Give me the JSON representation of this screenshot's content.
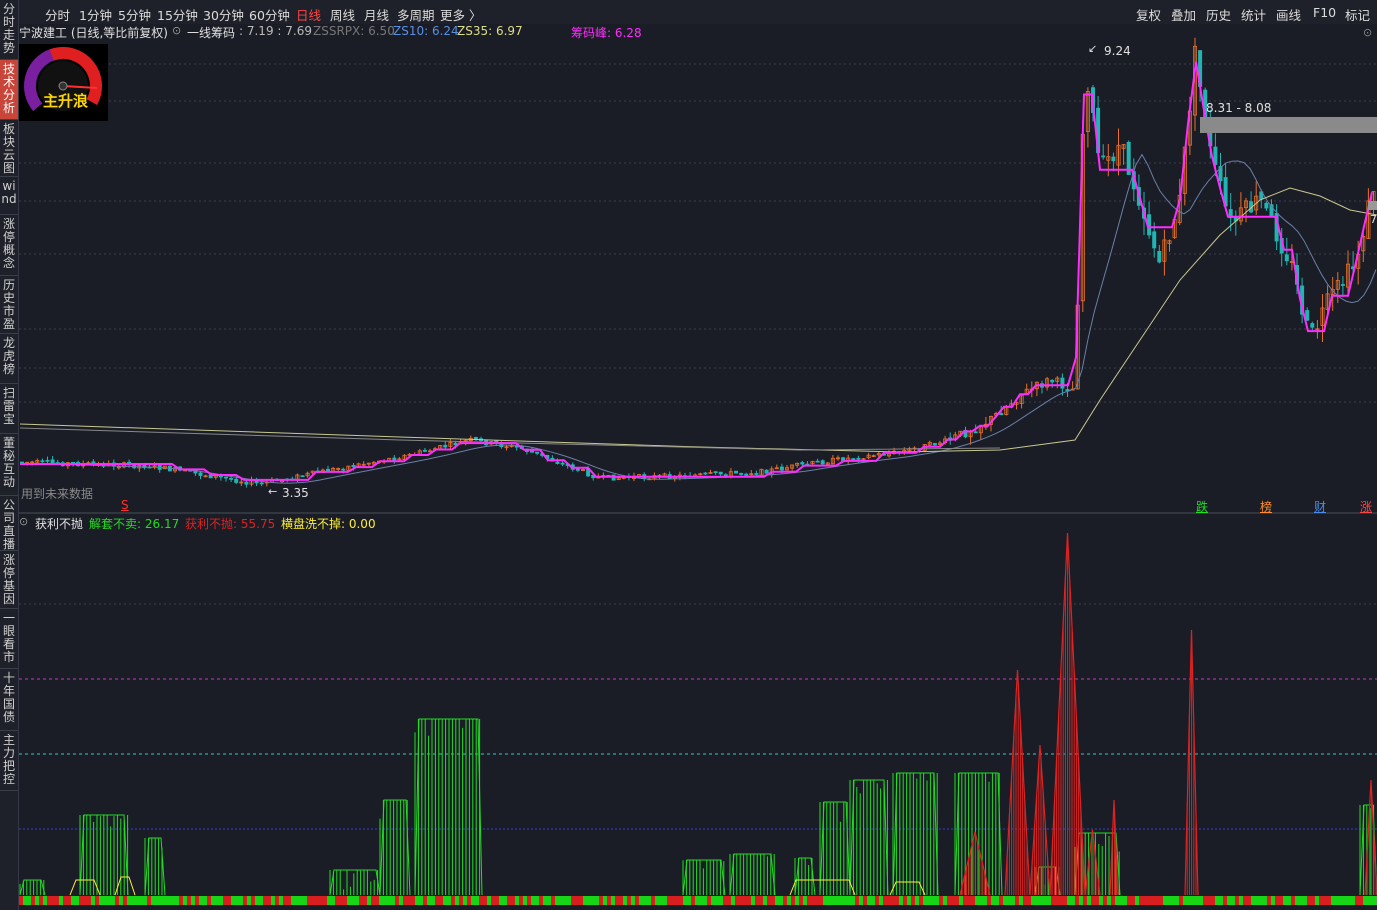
{
  "sidebar": {
    "items": [
      {
        "label": "分时走势",
        "active": false
      },
      {
        "label": "技术分析",
        "active": true
      },
      {
        "label": "板块云图",
        "active": false
      },
      {
        "label": "wind",
        "active": false
      },
      {
        "label": "涨停概念",
        "active": false
      },
      {
        "label": "历史市盈",
        "active": false
      },
      {
        "label": "龙虎榜",
        "active": false
      },
      {
        "label": "扫雷宝",
        "active": false
      },
      {
        "label": "董秘互动",
        "active": false
      },
      {
        "label": "公司直播",
        "active": false
      },
      {
        "label": "涨停基因",
        "active": false
      },
      {
        "label": "一眼看市",
        "active": false
      },
      {
        "label": "十年国债",
        "active": false
      },
      {
        "label": "主力把控",
        "active": false
      }
    ]
  },
  "toolbar": {
    "left_items": [
      {
        "label": "分时",
        "active": false
      },
      {
        "label": "1分钟",
        "active": false
      },
      {
        "label": "5分钟",
        "active": false
      },
      {
        "label": "15分钟",
        "active": false
      },
      {
        "label": "30分钟",
        "active": false
      },
      {
        "label": "60分钟",
        "active": false
      },
      {
        "label": "日线",
        "active": true
      },
      {
        "label": "周线",
        "active": false
      },
      {
        "label": "月线",
        "active": false
      },
      {
        "label": "多周期",
        "active": false
      },
      {
        "label": "更多 〉",
        "active": false
      }
    ],
    "right_items": [
      "复权",
      "叠加",
      "历史",
      "统计",
      "画线",
      "F10",
      "标记"
    ]
  },
  "main_info": {
    "title": "宁波建工 (日线,等比前复权)",
    "indicator_name": "一线筹码",
    "indicator_value": ": 7.19 : 7.69",
    "zssrpx": "ZSSRPX: 6.50",
    "zs10": "ZS10: 6.24",
    "zs35": "ZS35: 6.97",
    "chip_peak": "筹码峰: 6.28"
  },
  "price_annotations": {
    "high": "9.24",
    "low": "3.35",
    "range": "8.31 - 8.08",
    "right_edge": "7",
    "future_data": "用到未来数据"
  },
  "event_markers": {
    "s_marker": "S",
    "die": "跌",
    "bang": "榜",
    "cai": "财",
    "zhang": "涨"
  },
  "sub_info": {
    "name": "获利不抛",
    "jt": "解套不卖: 26.17",
    "hl": "获利不抛: 55.75",
    "hp": "横盘洗不掉: 0.00"
  },
  "colors": {
    "background": "#1a1d26",
    "up_candle": "#e8702a",
    "down_candle": "#22b3b3",
    "chip_line": "#ff2cff",
    "active_red": "#ff4646",
    "green_bar": "#22dd22",
    "red_bar": "#dd2222",
    "yellow_line": "#ffee33"
  }
}
